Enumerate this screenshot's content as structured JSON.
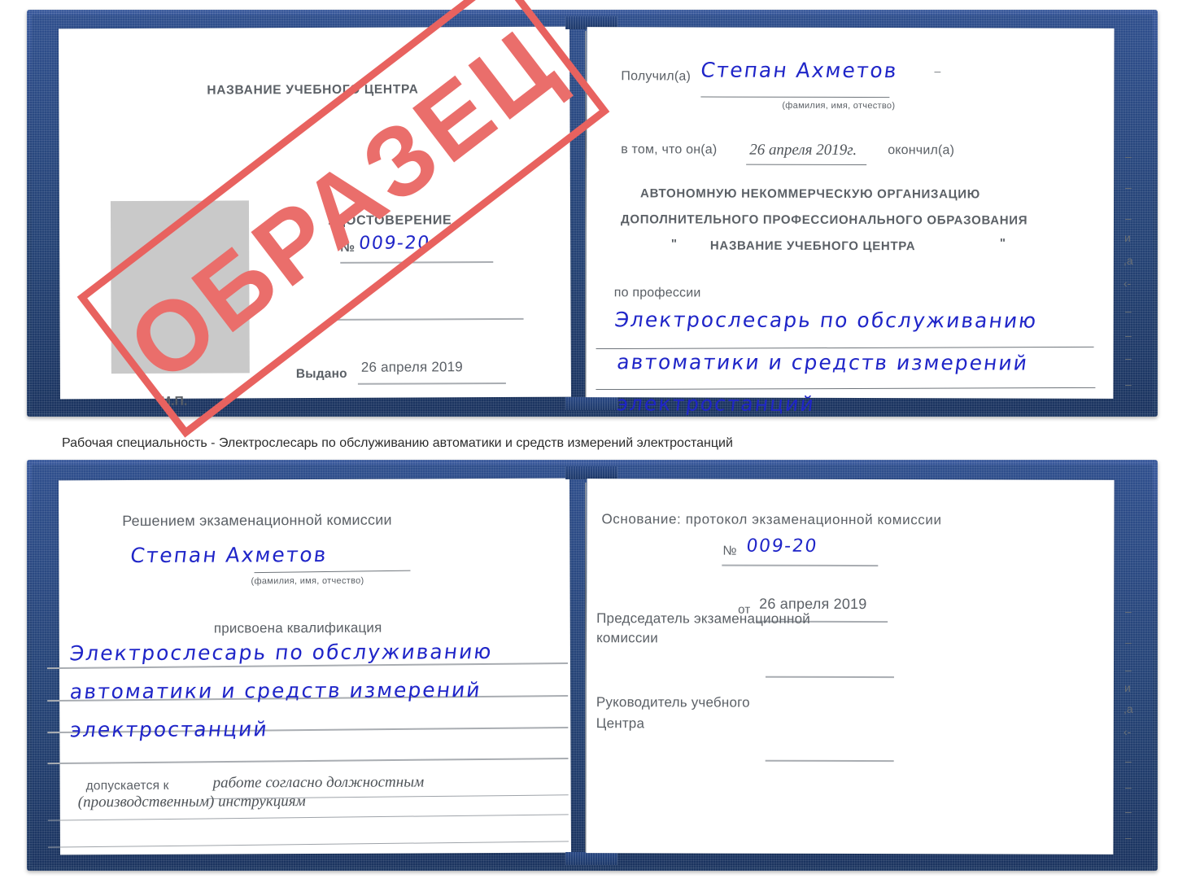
{
  "caption": {
    "text": "Рабочая специальность - Электрослесарь по обслуживанию автоматики и средств измерений электростанций"
  },
  "stamp": {
    "label": "ОБРАЗЕЦ",
    "color": "#ea6e6b"
  },
  "handwriting_color": "#1f25c8",
  "certificate_top": {
    "left_page": {
      "center_name": "НАЗВАНИЕ УЧЕБНОГО ЦЕНТРА",
      "doc_title": "УДОСТОВЕРЕНИЕ",
      "number_label": "№",
      "number_value": "009-20",
      "issued_label": "Выдано",
      "issued_value": "26 апреля 2019",
      "seal_label": "М.П."
    },
    "right_page": {
      "received_label": "Получил(а)",
      "received_value": "Степан Ахметов",
      "name_hint": "(фамилия, имя, отчество)",
      "that_he_label": "в том, что он(а)",
      "finish_date": "26 апреля 2019г.",
      "finished_label": "окончил(а)",
      "org_line1": "АВТОНОМНУЮ НЕКОММЕРЧЕСКУЮ ОРГАНИЗАЦИЮ",
      "org_line2": "ДОПОЛНИТЕЛЬНОГО ПРОФЕССИОНАЛЬНОГО ОБРАЗОВАНИЯ",
      "org_quote_open": "\"",
      "org_line3": "НАЗВАНИЕ УЧЕБНОГО ЦЕНТРА",
      "org_quote_close": "\"",
      "profession_label": "по профессии",
      "profession_line1": "Электрослесарь по обслуживанию",
      "profession_line2": "автоматики и средств измерений",
      "profession_line3": "электростанций",
      "edge_fragments": [
        "–",
        "–",
        "–",
        "и",
        ",а",
        "‹-",
        "–",
        "–",
        "–",
        "–"
      ]
    }
  },
  "certificate_bottom": {
    "left_page": {
      "decision_title": "Решением экзаменационной комиссии",
      "name_value": "Степан Ахметов",
      "name_hint": "(фамилия, имя, отчество)",
      "qualification_label": "присвоена квалификация",
      "qualification_line1": "Электрослесарь по обслуживанию",
      "qualification_line2": "автоматики и средств измерений",
      "qualification_line3": "электростанций",
      "admitted_label": "допускается к",
      "admitted_value_line1": "работе согласно должностным",
      "admitted_value_line2": "(производственным) инструкциям"
    },
    "right_page": {
      "basis_label": "Основание: протокол экзаменационной комиссии",
      "number_label": "№",
      "number_value": "009-20",
      "date_label": "от",
      "date_value": "26 апреля 2019",
      "chairman_line1": "Председатель экзаменационной",
      "chairman_line2": "комиссии",
      "head_line1": "Руководитель учебного",
      "head_line2": "Центра",
      "edge_fragments": [
        "–",
        "–",
        "–",
        "и",
        ",а",
        "‹-",
        "–",
        "–",
        "–",
        "–"
      ]
    }
  }
}
